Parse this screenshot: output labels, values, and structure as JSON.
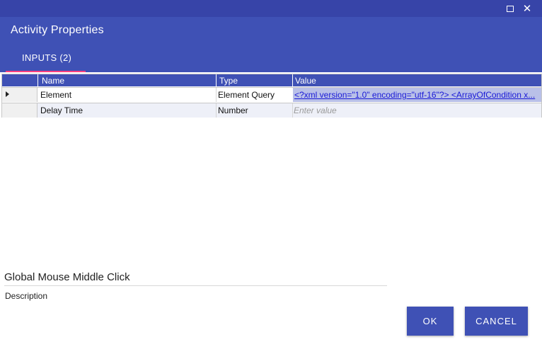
{
  "window": {
    "maximize_icon": "maximize-icon",
    "close_icon": "close-icon",
    "close_glyph": "✕"
  },
  "dialog": {
    "title": "Activity Properties",
    "tabs": [
      {
        "label": "INPUTS (2)",
        "active": true
      }
    ],
    "accent_color": "#ff4081",
    "header_color": "#3f51b5"
  },
  "grid": {
    "columns": [
      "Name",
      "Type",
      "Value"
    ],
    "rows": [
      {
        "name": "Element",
        "type": "Element Query",
        "value": "<?xml version=\"1.0\" encoding=\"utf-16\"?> <ArrayOfCondition x...",
        "selected": true
      },
      {
        "name": "Delay Time",
        "type": "Number",
        "placeholder": "Enter value"
      }
    ]
  },
  "activity": {
    "name": "Global Mouse Middle Click",
    "description_label": "Description"
  },
  "buttons": {
    "ok": "OK",
    "cancel": "CANCEL"
  }
}
